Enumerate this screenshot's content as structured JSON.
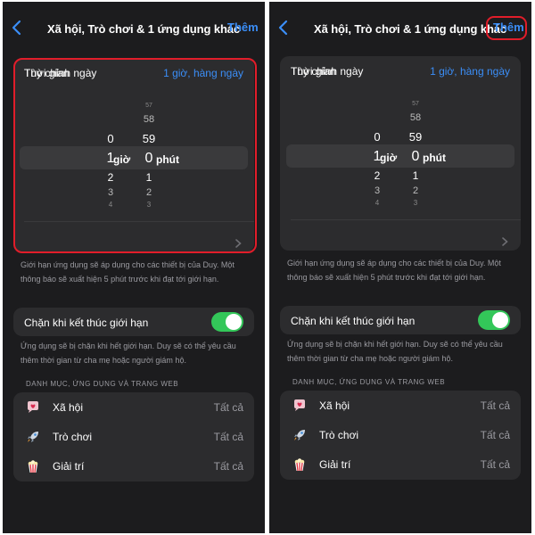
{
  "nav": {
    "title": "Xã hội, Trò chơi & 1 ứng dụng khác",
    "add_label": "Thêm"
  },
  "time_card": {
    "label": "Thời gian",
    "value": "1 giờ, hàng ngày",
    "custom_label": "Tùy chỉnh ngày"
  },
  "picker": {
    "hours_above": [
      "0"
    ],
    "hours_selected": "1",
    "hours_below": [
      "2",
      "3",
      "4"
    ],
    "hours_unit": "giờ",
    "minutes_above": [
      "57",
      "58",
      "59"
    ],
    "minutes_selected": "0",
    "minutes_below": [
      "1",
      "2",
      "3"
    ],
    "minutes_unit": "phút"
  },
  "limit_note": "Giới hạn ứng dụng sẽ áp dụng cho các thiết bị của Duy. Một thông báo sẽ xuất hiện 5 phút trước khi đạt tới giới hạn.",
  "block": {
    "label": "Chặn khi kết thúc giới hạn",
    "enabled": true
  },
  "block_note": "Ứng dụng sẽ bị chặn khi hết giới hạn. Duy sẽ có thể yêu cầu thêm thời gian từ cha mẹ hoặc người giám hộ.",
  "section_header": "DANH MỤC, ỨNG DỤNG VÀ TRANG WEB",
  "apps": [
    {
      "name": "Xã hội",
      "value": "Tất cả",
      "icon": "speech-bubble-heart-icon"
    },
    {
      "name": "Trò chơi",
      "value": "Tất cả",
      "icon": "rocket-icon"
    },
    {
      "name": "Giải trí",
      "value": "Tất cả",
      "icon": "popcorn-icon"
    }
  ],
  "colors": {
    "accent": "#3b8ef7",
    "toggle_on": "#33c759",
    "highlight": "#e11d2a",
    "background": "#1c1c1e",
    "card": "#2c2c2e"
  }
}
